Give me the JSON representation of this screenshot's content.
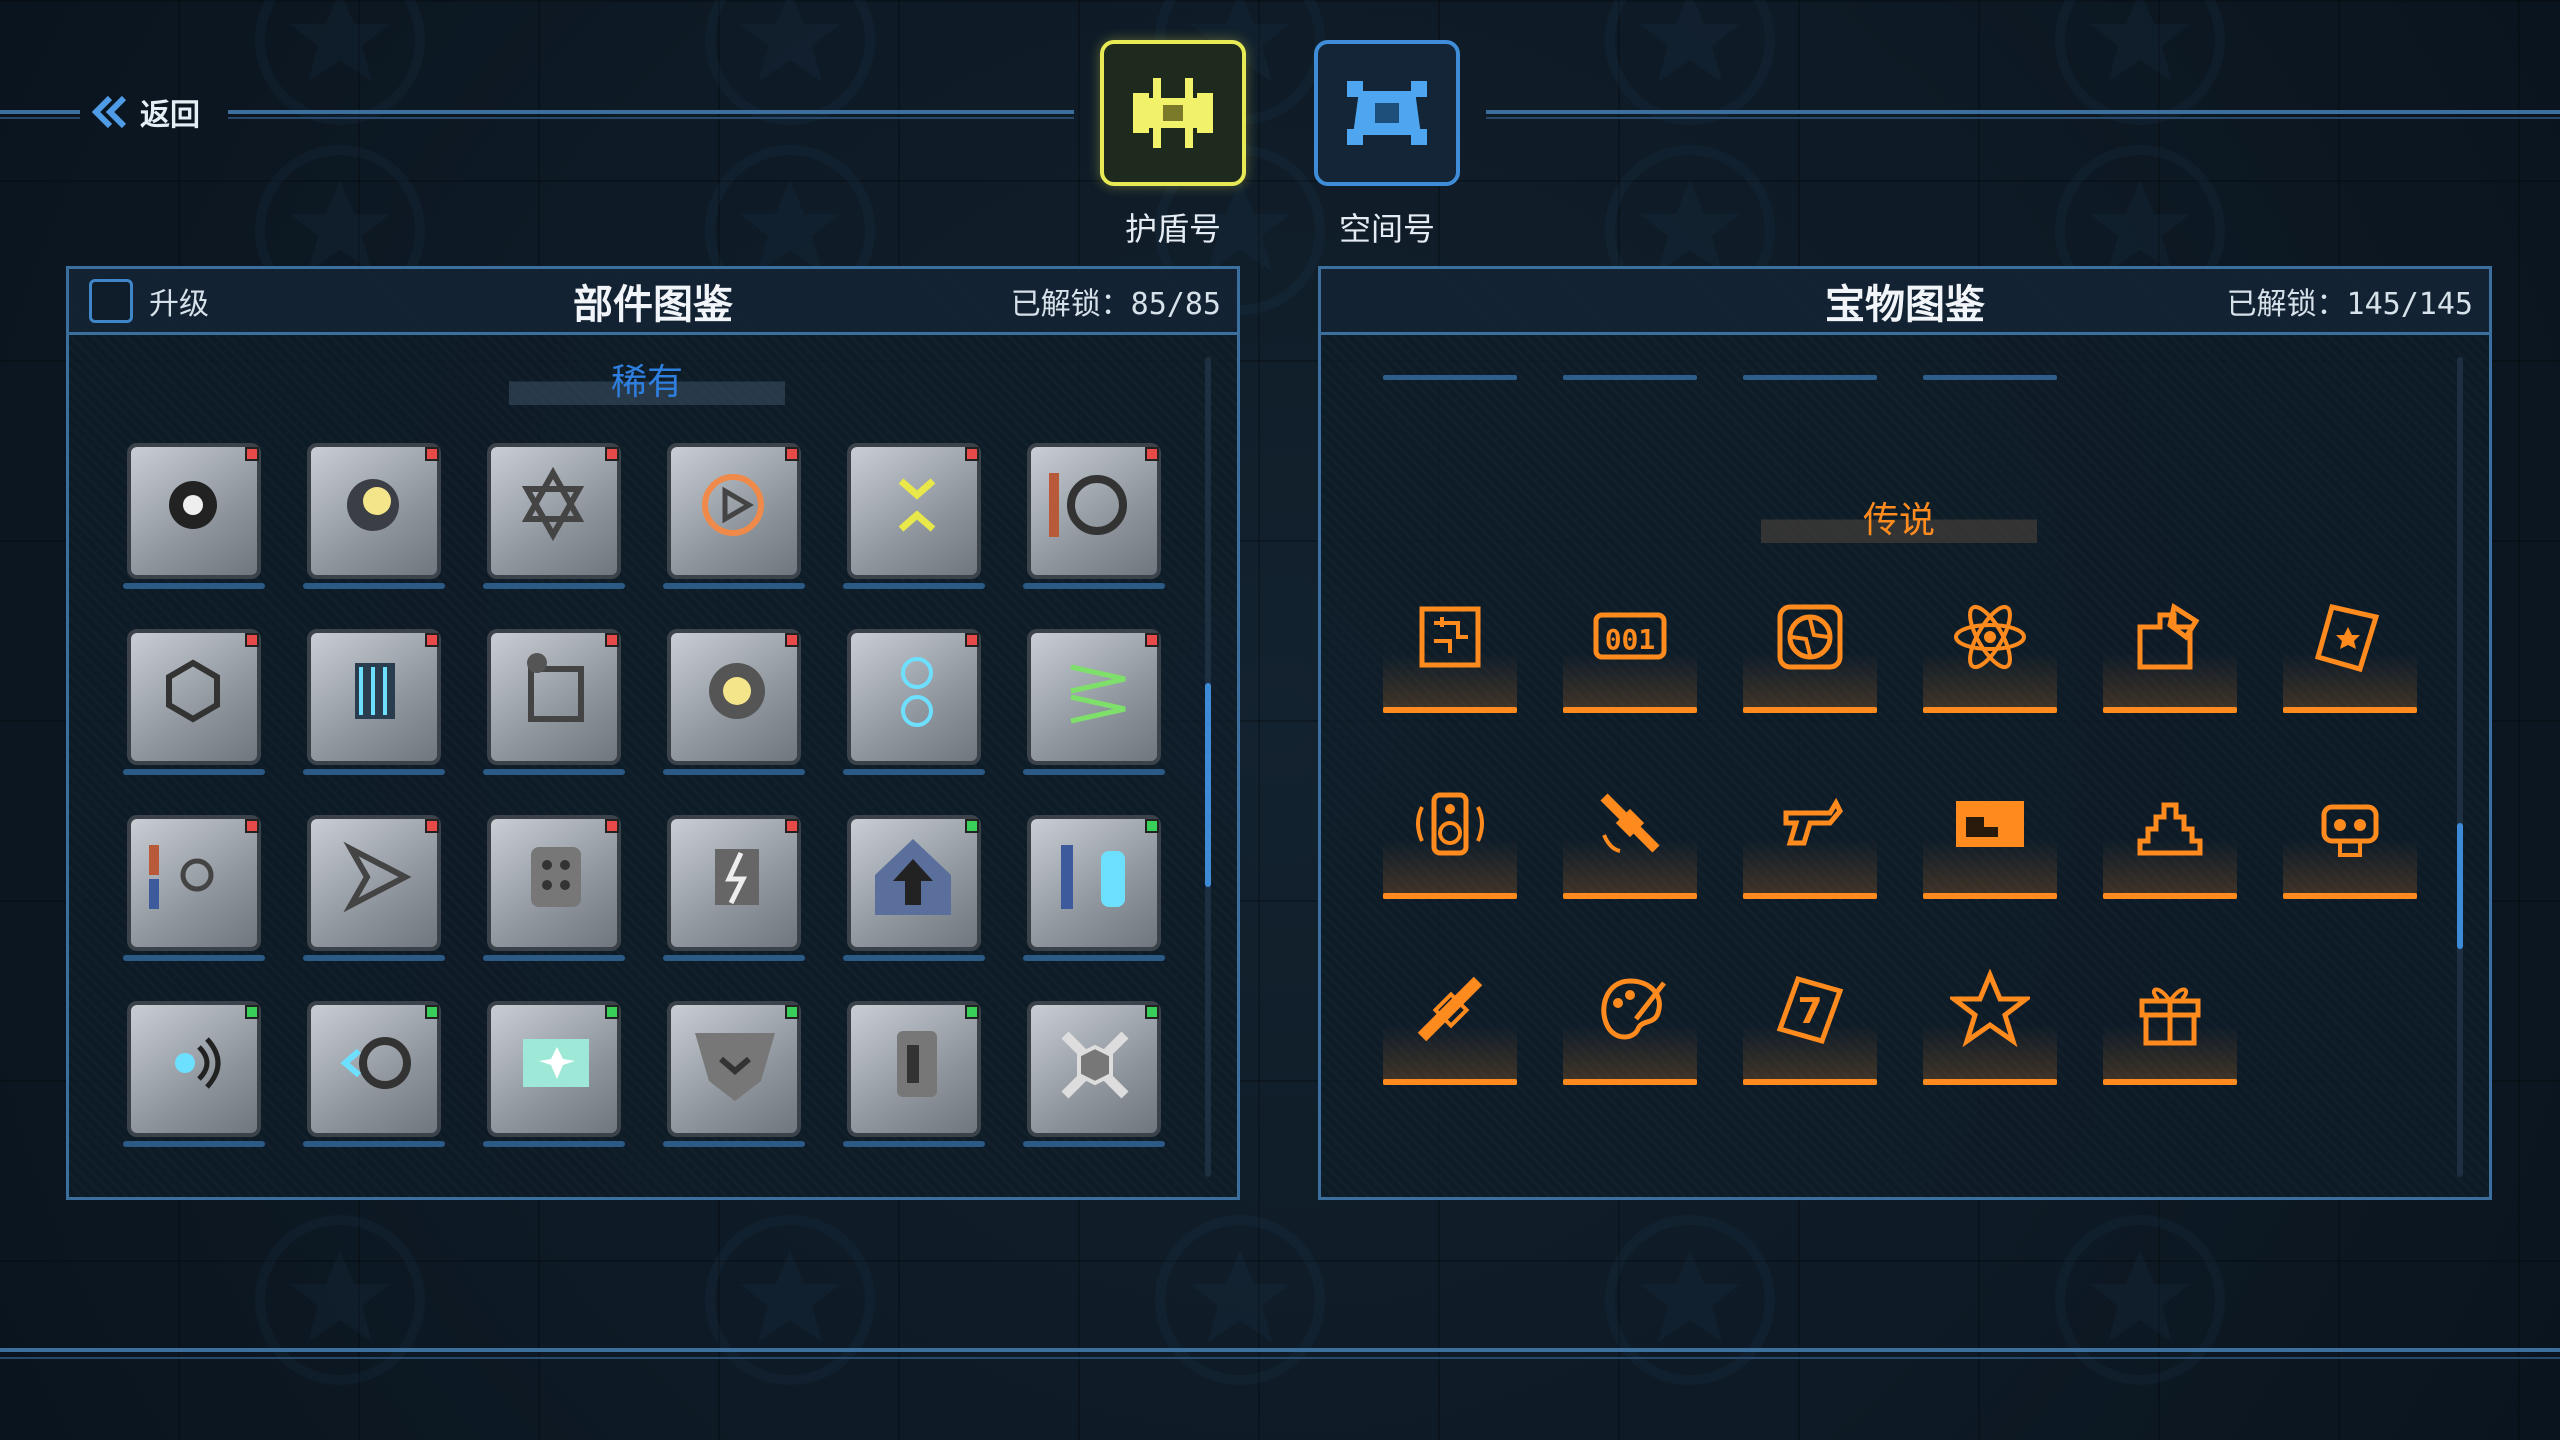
{
  "nav": {
    "back_label": "返回"
  },
  "ships": [
    {
      "name": "护盾号",
      "selected": true,
      "color": "#e8ea55"
    },
    {
      "name": "空间号",
      "selected": false,
      "color": "#3f8dd9"
    }
  ],
  "parts_panel": {
    "title": "部件图鉴",
    "unlock_label": "已解锁：85/85",
    "upgrade_label": "升级",
    "upgrade_checked": false,
    "category": "稀有",
    "items": [
      {
        "icon": "explosion-part-icon",
        "status": "red"
      },
      {
        "icon": "moon-part-icon",
        "status": "red"
      },
      {
        "icon": "hexagram-part-icon",
        "status": "red"
      },
      {
        "icon": "play-circle-part-icon",
        "status": "red"
      },
      {
        "icon": "chevron-part-icon",
        "status": "red"
      },
      {
        "icon": "dragon-part-icon",
        "status": "red"
      },
      {
        "icon": "hexagon-part-icon",
        "status": "red"
      },
      {
        "icon": "coil-part-icon",
        "status": "red"
      },
      {
        "icon": "gear-frame-part-icon",
        "status": "red"
      },
      {
        "icon": "gear-core-part-icon",
        "status": "red"
      },
      {
        "icon": "twin-crosshair-part-icon",
        "status": "red"
      },
      {
        "icon": "laser-arrows-part-icon",
        "status": "red"
      },
      {
        "icon": "connector-part-icon",
        "status": "red"
      },
      {
        "icon": "bracket-part-icon",
        "status": "red"
      },
      {
        "icon": "armor-plate-part-icon",
        "status": "red"
      },
      {
        "icon": "lightning-part-icon",
        "status": "red"
      },
      {
        "icon": "up-arrow-part-icon",
        "status": "green"
      },
      {
        "icon": "tank-part-icon",
        "status": "green"
      },
      {
        "icon": "sonar-part-icon",
        "status": "green"
      },
      {
        "icon": "cog-emitter-part-icon",
        "status": "green"
      },
      {
        "icon": "spark-cell-part-icon",
        "status": "green"
      },
      {
        "icon": "chevron-shield-part-icon",
        "status": "green"
      },
      {
        "icon": "side-panel-part-icon",
        "status": "green"
      },
      {
        "icon": "cross-joint-part-icon",
        "status": "green"
      }
    ]
  },
  "treasure_panel": {
    "title": "宝物图鉴",
    "unlock_label": "已解锁：145/145",
    "category": "传说",
    "accent": "#ff8a1e",
    "items": [
      {
        "icon": "circuit-chip-icon"
      },
      {
        "icon": "counter-001-icon"
      },
      {
        "icon": "fan-icon"
      },
      {
        "icon": "atom-icon"
      },
      {
        "icon": "puzzle-icon"
      },
      {
        "icon": "scroll-icon"
      },
      {
        "icon": "speaker-icon"
      },
      {
        "icon": "satellite-icon"
      },
      {
        "icon": "revolver-icon"
      },
      {
        "icon": "flag-card-icon"
      },
      {
        "icon": "stairs-icon"
      },
      {
        "icon": "engine-icon"
      },
      {
        "icon": "space-station-icon"
      },
      {
        "icon": "palette-icon"
      },
      {
        "icon": "lucky-seven-card-icon"
      },
      {
        "icon": "star-icon"
      },
      {
        "icon": "gift-box-icon"
      }
    ]
  }
}
